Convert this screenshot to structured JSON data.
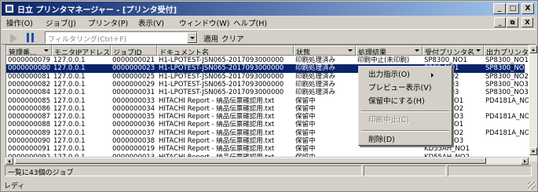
{
  "window": {
    "title": "日立 プリンタマネージャー - [プリンタ受付]"
  },
  "title_buttons": {
    "minimize": "_",
    "maximize": "□",
    "close": "X"
  },
  "mdi_buttons": {
    "minimize": "_",
    "restore": "⧉",
    "close": "X"
  },
  "menu": [
    "操作(O)",
    "ジョブ(J)",
    "プリンタ(P)",
    "表示(V)",
    "ウィンドウ(W)",
    "ヘルプ(H)"
  ],
  "toolbar": {
    "filter_placeholder": "フィルタリング(Ctrl＋F)",
    "apply_label": "適用",
    "clear_label": "クリア"
  },
  "columns": [
    "管理番...",
    "モニタIPアドレス",
    "ジョブID",
    "ドキュメント名",
    "状態",
    "処理結果",
    "受付プリンタ名",
    "出力プリンタ名"
  ],
  "rows": [
    {
      "no": "0000000079",
      "ip": "127.0.0.1",
      "job": "0000000021",
      "doc": "H1-LPOTEST-JSN065-2017093000000",
      "state": "印刷処理済み",
      "result": "印刷中止(未印刷)",
      "recv": "SP8300_NO1",
      "out": "SP8300_NO1",
      "selected": false
    },
    {
      "no": "0000000080",
      "ip": "127.0.0.1",
      "job": "0000000023",
      "doc": "H1-LPOTEST-JSN065-2017093000000",
      "state": "印刷処理済み",
      "result": "",
      "recv": "8300_NO1",
      "out": "SP8300_NO1",
      "selected": true
    },
    {
      "no": "0000000081",
      "ip": "127.0.0.1",
      "job": "0000000025",
      "doc": "H1-LPOTEST-JSN065-2017093000000",
      "state": "印刷処理済み",
      "result": "",
      "recv": "8300_NO2",
      "out": "SP8300_NO2",
      "selected": false
    },
    {
      "no": "0000000082",
      "ip": "127.0.0.1",
      "job": "0000000029",
      "doc": "H1-LPOTEST-JSN065-2017093000000",
      "state": "印刷処理済み",
      "result": "",
      "recv": "8300_NO3",
      "out": "SP8300_NO3",
      "selected": false
    },
    {
      "no": "0000000084",
      "ip": "127.0.0.1",
      "job": "0000000031",
      "doc": "H1-LPOTEST-JSN065-2017093000000",
      "state": "印刷処理済み",
      "result": "",
      "recv": "8300_NO3",
      "out": "SP8300_NO3",
      "selected": false
    },
    {
      "no": "0000000085",
      "ip": "127.0.0.1",
      "job": "0000000033",
      "doc": "HITACHI Report - 納品伝票確認用.txt",
      "state": "保留中",
      "result": "",
      "recv": "4181A_NO1",
      "out": "PD4181A_NO",
      "selected": false
    },
    {
      "no": "0000000086",
      "ip": "127.0.0.1",
      "job": "0000000034",
      "doc": "HITACHI Report - 納品伝票確認用.txt",
      "state": "保留中",
      "result": "",
      "recv": "4181A_NO2",
      "out": "",
      "selected": false
    },
    {
      "no": "0000000087",
      "ip": "127.0.0.1",
      "job": "0000000035",
      "doc": "HITACHI Report - 納品伝票確認用.txt",
      "state": "保留中",
      "result": "",
      "recv": "4181A_NO3",
      "out": "PD4181A_NO",
      "selected": false
    },
    {
      "no": "0000000088",
      "ip": "127.0.0.1",
      "job": "0000000036",
      "doc": "HITACHI Report - 納品伝票確認用.txt",
      "state": "保留中",
      "result": "",
      "recv": "4181A_NO1",
      "out": "",
      "selected": false
    },
    {
      "no": "0000000089",
      "ip": "127.0.0.1",
      "job": "0000000037",
      "doc": "HITACHI Report - 納品伝票確認用.txt",
      "state": "保留中",
      "result": "",
      "recv": "4181A_NO2",
      "out": "PD4181A_NO",
      "selected": false
    },
    {
      "no": "0000000090",
      "ip": "127.0.0.1",
      "job": "0000000038",
      "doc": "HITACHI Report - 納品伝票確認用.txt",
      "state": "保留中",
      "result": "",
      "recv": "4181A_NO3",
      "out": "",
      "selected": false
    },
    {
      "no": "0000000091",
      "ip": "127.0.0.1",
      "job": "0000000019",
      "doc": "HITACHI Report - 納品伝票確認用.txt",
      "state": "保留中",
      "result": "",
      "recv": "KD55AH_NO1",
      "out": "",
      "selected": false
    },
    {
      "no": "0000000092",
      "ip": "127.0.0.1",
      "job": "0000000013",
      "doc": "HITACHI Report - 納品伝票確認用.txt",
      "state": "保留中",
      "result": "",
      "recv": "KD55AH_NO2",
      "out": "",
      "selected": false
    }
  ],
  "context_menu": [
    {
      "label": "出力指示(O)",
      "submenu": true,
      "disabled": false
    },
    {
      "label": "プレビュー表示(V)",
      "submenu": false,
      "disabled": false
    },
    {
      "label": "保留中にする(H)",
      "submenu": false,
      "disabled": false
    },
    {
      "label": "印刷中止(C)",
      "submenu": false,
      "disabled": true
    },
    {
      "label": "削除(D)",
      "submenu": false,
      "disabled": false
    }
  ],
  "status": {
    "count_text": "一覧に43個のジョブ",
    "ready_text": "レディ"
  },
  "colors": {
    "title_start": "#0a246a",
    "title_end": "#a6caf0",
    "selection": "#0a246a",
    "face": "#d4d0c8"
  }
}
